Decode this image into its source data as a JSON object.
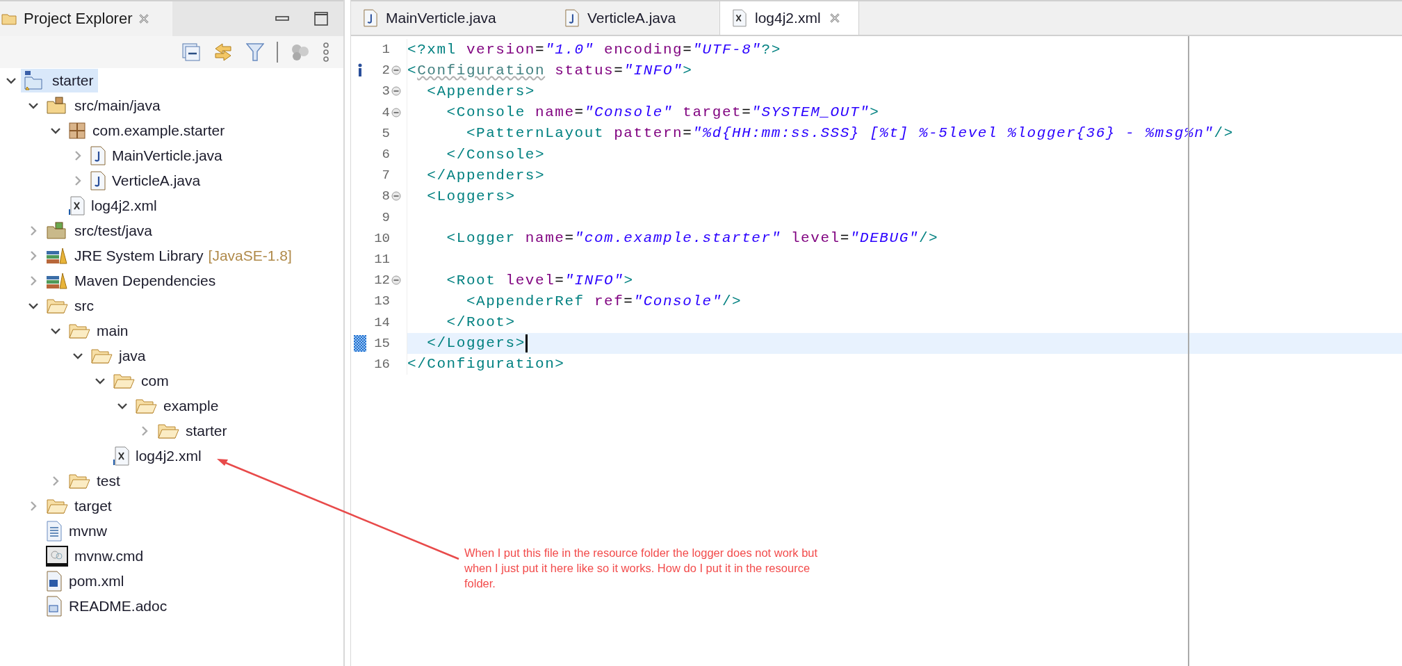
{
  "project_explorer": {
    "title": "Project Explorer",
    "tree": [
      {
        "label": "starter",
        "kind": "project",
        "expanded": true,
        "selected": true,
        "children": [
          {
            "label": "src/main/java",
            "kind": "source-folder",
            "expanded": true,
            "selected": false,
            "children": [
              {
                "label": "com.example.starter",
                "kind": "package",
                "expanded": true,
                "selected": false,
                "children": [
                  {
                    "label": "MainVerticle.java",
                    "kind": "java",
                    "expanded": false,
                    "selected": false
                  },
                  {
                    "label": "VerticleA.java",
                    "kind": "java",
                    "expanded": false,
                    "selected": false
                  }
                ]
              },
              {
                "label": "log4j2.xml",
                "kind": "xml",
                "selected": false
              }
            ]
          },
          {
            "label": "src/test/java",
            "kind": "test-folder",
            "expanded": false,
            "selected": false
          },
          {
            "label": "JRE System Library",
            "decoration": "[JavaSE-1.8]",
            "kind": "library",
            "expanded": false,
            "selected": false
          },
          {
            "label": "Maven Dependencies",
            "kind": "library",
            "expanded": false,
            "selected": false
          },
          {
            "label": "src",
            "kind": "folder",
            "expanded": true,
            "selected": false,
            "children": [
              {
                "label": "main",
                "kind": "folder",
                "expanded": true,
                "selected": false,
                "children": [
                  {
                    "label": "java",
                    "kind": "folder",
                    "expanded": true,
                    "selected": false,
                    "children": [
                      {
                        "label": "com",
                        "kind": "folder",
                        "expanded": true,
                        "selected": false,
                        "children": [
                          {
                            "label": "example",
                            "kind": "folder",
                            "expanded": true,
                            "selected": false,
                            "children": [
                              {
                                "label": "starter",
                                "kind": "folder",
                                "expanded": false,
                                "selected": false
                              }
                            ]
                          }
                        ]
                      },
                      {
                        "label": "log4j2.xml",
                        "kind": "xml",
                        "selected": false
                      }
                    ]
                  }
                ]
              },
              {
                "label": "test",
                "kind": "folder",
                "expanded": false,
                "selected": false
              }
            ]
          },
          {
            "label": "target",
            "kind": "folder",
            "expanded": false,
            "selected": false
          },
          {
            "label": "mvnw",
            "kind": "text",
            "selected": false
          },
          {
            "label": "mvnw.cmd",
            "kind": "cmd",
            "selected": false
          },
          {
            "label": "pom.xml",
            "kind": "maven",
            "selected": false
          },
          {
            "label": "README.adoc",
            "kind": "word",
            "selected": false
          }
        ]
      }
    ]
  },
  "editor": {
    "tabs": [
      {
        "label": "MainVerticle.java",
        "kind": "java",
        "selected": false
      },
      {
        "label": "VerticleA.java",
        "kind": "java",
        "selected": false
      },
      {
        "label": "log4j2.xml",
        "kind": "xml",
        "selected": true
      }
    ],
    "lines": [
      {
        "number": "1",
        "foldable": false,
        "info": false,
        "changed": false,
        "current": false,
        "tokens": [
          {
            "kind": "tag",
            "text": "<?xml"
          },
          {
            "kind": "attr",
            "text": " version"
          },
          {
            "kind": "text",
            "text": "="
          },
          {
            "kind": "value",
            "text": "\"1.0\""
          },
          {
            "kind": "attr",
            "text": " encoding"
          },
          {
            "kind": "text",
            "text": "="
          },
          {
            "kind": "value",
            "text": "\"UTF-8\""
          },
          {
            "kind": "tag",
            "text": "?>"
          }
        ]
      },
      {
        "number": "2",
        "foldable": true,
        "info": true,
        "changed": false,
        "current": false,
        "tokens": [
          {
            "kind": "tag",
            "text": "<"
          },
          {
            "kind": "warn",
            "text": "Configuration"
          },
          {
            "kind": "attr",
            "text": " status"
          },
          {
            "kind": "text",
            "text": "="
          },
          {
            "kind": "value",
            "text": "\"INFO\""
          },
          {
            "kind": "tag",
            "text": ">"
          }
        ]
      },
      {
        "number": "3",
        "foldable": true,
        "info": false,
        "changed": false,
        "current": false,
        "tokens": [
          {
            "kind": "tag",
            "text": "  <Appenders>"
          }
        ]
      },
      {
        "number": "4",
        "foldable": true,
        "info": false,
        "changed": false,
        "current": false,
        "tokens": [
          {
            "kind": "tag",
            "text": "    <Console"
          },
          {
            "kind": "attr",
            "text": " name"
          },
          {
            "kind": "text",
            "text": "="
          },
          {
            "kind": "value",
            "text": "\"Console\""
          },
          {
            "kind": "attr",
            "text": " target"
          },
          {
            "kind": "text",
            "text": "="
          },
          {
            "kind": "value",
            "text": "\"SYSTEM_OUT\""
          },
          {
            "kind": "tag",
            "text": ">"
          }
        ]
      },
      {
        "number": "5",
        "foldable": false,
        "info": false,
        "changed": false,
        "current": false,
        "tokens": [
          {
            "kind": "tag",
            "text": "      <PatternLayout"
          },
          {
            "kind": "attr",
            "text": " pattern"
          },
          {
            "kind": "text",
            "text": "="
          },
          {
            "kind": "value",
            "text": "\"%d{HH:mm:ss.SSS} [%t] %-5level %logger{36} - %msg%n\""
          },
          {
            "kind": "tag",
            "text": "/>"
          }
        ]
      },
      {
        "number": "6",
        "foldable": false,
        "info": false,
        "changed": false,
        "current": false,
        "tokens": [
          {
            "kind": "tag",
            "text": "    </Console>"
          }
        ]
      },
      {
        "number": "7",
        "foldable": false,
        "info": false,
        "changed": false,
        "current": false,
        "tokens": [
          {
            "kind": "tag",
            "text": "  </Appenders>"
          }
        ]
      },
      {
        "number": "8",
        "foldable": true,
        "info": false,
        "changed": false,
        "current": false,
        "tokens": [
          {
            "kind": "tag",
            "text": "  <Loggers>"
          }
        ]
      },
      {
        "number": "9",
        "foldable": false,
        "info": false,
        "changed": false,
        "current": false
      },
      {
        "number": "10",
        "foldable": false,
        "info": false,
        "changed": false,
        "current": false,
        "tokens": [
          {
            "kind": "tag",
            "text": "    <Logger"
          },
          {
            "kind": "attr",
            "text": " name"
          },
          {
            "kind": "text",
            "text": "="
          },
          {
            "kind": "value",
            "text": "\"com.example.starter\""
          },
          {
            "kind": "attr",
            "text": " level"
          },
          {
            "kind": "text",
            "text": "="
          },
          {
            "kind": "value",
            "text": "\"DEBUG\""
          },
          {
            "kind": "tag",
            "text": "/>"
          }
        ]
      },
      {
        "number": "11",
        "foldable": false,
        "info": false,
        "changed": false,
        "current": false
      },
      {
        "number": "12",
        "foldable": true,
        "info": false,
        "changed": false,
        "current": false,
        "tokens": [
          {
            "kind": "tag",
            "text": "    <Root"
          },
          {
            "kind": "attr",
            "text": " level"
          },
          {
            "kind": "text",
            "text": "="
          },
          {
            "kind": "value",
            "text": "\"INFO\""
          },
          {
            "kind": "tag",
            "text": ">"
          }
        ]
      },
      {
        "number": "13",
        "foldable": false,
        "info": false,
        "changed": false,
        "current": false,
        "tokens": [
          {
            "kind": "tag",
            "text": "      <AppenderRef"
          },
          {
            "kind": "attr",
            "text": " ref"
          },
          {
            "kind": "text",
            "text": "="
          },
          {
            "kind": "value",
            "text": "\"Console\""
          },
          {
            "kind": "tag",
            "text": "/>"
          }
        ]
      },
      {
        "number": "14",
        "foldable": false,
        "info": false,
        "changed": false,
        "current": false,
        "tokens": [
          {
            "kind": "tag",
            "text": "    </Root>"
          }
        ]
      },
      {
        "number": "15",
        "foldable": false,
        "info": false,
        "changed": true,
        "current": true,
        "tokens": [
          {
            "kind": "tag",
            "text": "  </Loggers>"
          }
        ]
      },
      {
        "number": "16",
        "foldable": false,
        "info": false,
        "changed": false,
        "current": false,
        "tokens": [
          {
            "kind": "tag",
            "text": "</Configuration>"
          }
        ]
      }
    ]
  },
  "annotation": {
    "note": "When I put this file in the resource folder the logger does not work but when I just put it here like so it works. How do I put it in the resource folder."
  }
}
